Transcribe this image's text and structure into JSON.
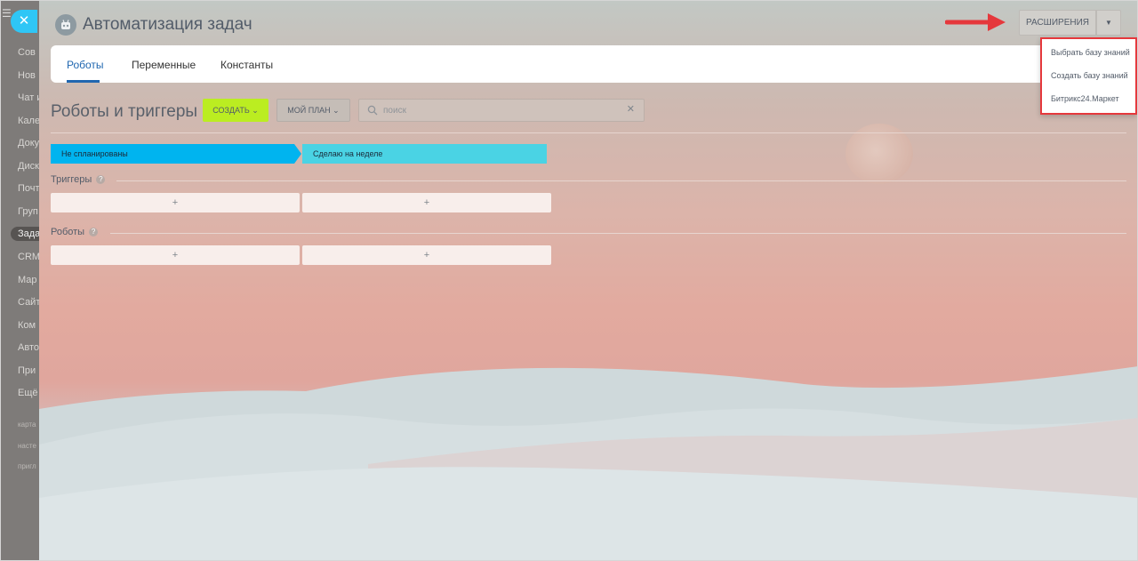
{
  "sidebar": {
    "items": [
      {
        "label": "Сов",
        "active": false
      },
      {
        "label": "Нов",
        "active": false
      },
      {
        "label": "Чат и",
        "active": false
      },
      {
        "label": "Кале",
        "active": false
      },
      {
        "label": "Доку",
        "active": false
      },
      {
        "label": "Диск",
        "active": false
      },
      {
        "label": "Почт",
        "active": false
      },
      {
        "label": "Груп",
        "active": false
      },
      {
        "label": "Зада",
        "active": true
      },
      {
        "label": "CRM",
        "active": false
      },
      {
        "label": "Мар",
        "active": false
      },
      {
        "label": "Сайт",
        "active": false
      },
      {
        "label": "Ком",
        "active": false
      },
      {
        "label": "Авто",
        "active": false
      },
      {
        "label": "При",
        "active": false
      },
      {
        "label": "Ещё",
        "active": false
      }
    ],
    "footer": [
      "карта",
      "насте",
      "пригл"
    ]
  },
  "header": {
    "title": "Автоматизация задач",
    "extensions_label": "РАСШИРЕНИЯ"
  },
  "tabs": [
    {
      "label": "Роботы",
      "active": true
    },
    {
      "label": "Переменные",
      "active": false
    },
    {
      "label": "Константы",
      "active": false
    }
  ],
  "toolbar": {
    "title": "Роботы и триггеры",
    "create_label": "СОЗДАТЬ",
    "plan_label": "МОЙ ПЛАН",
    "search_placeholder": "поиск"
  },
  "stages": [
    "Не спланированы",
    "Сделаю на неделе"
  ],
  "sections": {
    "triggers_label": "Триггеры",
    "robots_label": "Роботы",
    "add_symbol": "+",
    "help_symbol": "?"
  },
  "dropdown": {
    "items": [
      "Выбрать базу знаний",
      "Создать базу знаний",
      "Битрикс24.Маркет"
    ]
  },
  "colors": {
    "accent_blue": "#2067b0",
    "create_green": "#bbed21",
    "stage_blue": "#00b4ef",
    "stage_cyan": "#4ad3e4",
    "highlight_red": "#e5383c"
  }
}
